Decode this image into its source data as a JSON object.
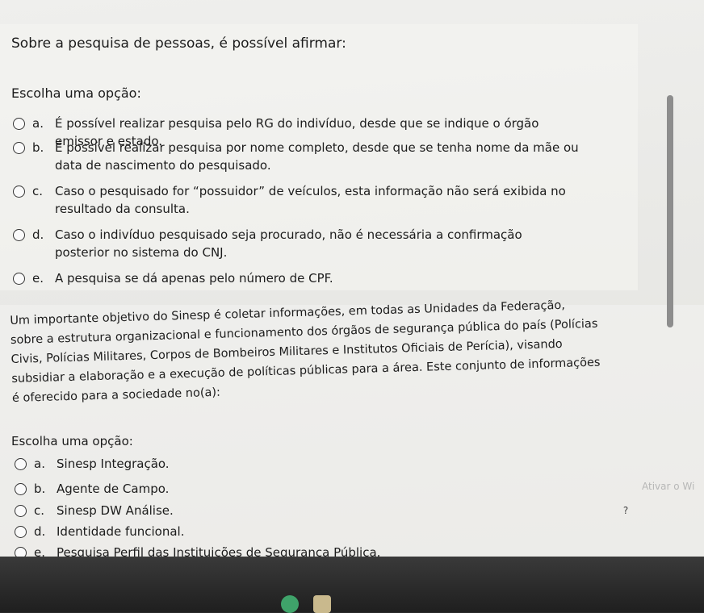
{
  "q1": {
    "question": "Sobre a pesquisa de pessoas, é possível afirmar:",
    "prompt": "Escolha uma opção:",
    "options": [
      {
        "letter": "a.",
        "text": "É possível realizar pesquisa pelo RG do indivíduo, desde que se indique o órgão emissor e estado."
      },
      {
        "letter": "b.",
        "text": "É possível realizar pesquisa por nome completo, desde que se tenha nome da mãe ou data de nascimento do pesquisado."
      },
      {
        "letter": "c.",
        "text": "Caso o pesquisado for “possuidor” de veículos, esta informação não será exibida no resultado da consulta."
      },
      {
        "letter": "d.",
        "text": "Caso o indivíduo pesquisado seja procurado, não é necessária a confirmação posterior no sistema do CNJ."
      },
      {
        "letter": "e.",
        "text": "A pesquisa se dá apenas pelo número de CPF."
      }
    ]
  },
  "q2": {
    "passage": "Um importante objetivo do Sinesp é coletar informações, em todas as Unidades da Federação, sobre a estrutura organizacional e funcionamento dos órgãos de segurança pública do país (Polícias Civis, Polícias Militares, Corpos de Bombeiros Militares e Institutos Oficiais de Perícia), visando subsidiar a elaboração e a execução de políticas públicas para a área. Este conjunto de informações é oferecido para a sociedade no(a):",
    "prompt": "Escolha uma opção:",
    "options": [
      {
        "letter": "a.",
        "text": "Sinesp Integração."
      },
      {
        "letter": "b.",
        "text": "Agente de Campo."
      },
      {
        "letter": "c.",
        "text": "Sinesp DW Análise."
      },
      {
        "letter": "d.",
        "text": "Identidade funcional."
      },
      {
        "letter": "e.",
        "text": "Pesquisa Perfil das Instituições de Segurança Pública."
      }
    ]
  },
  "watermark": "Ativar o Wi",
  "help_label": "?"
}
